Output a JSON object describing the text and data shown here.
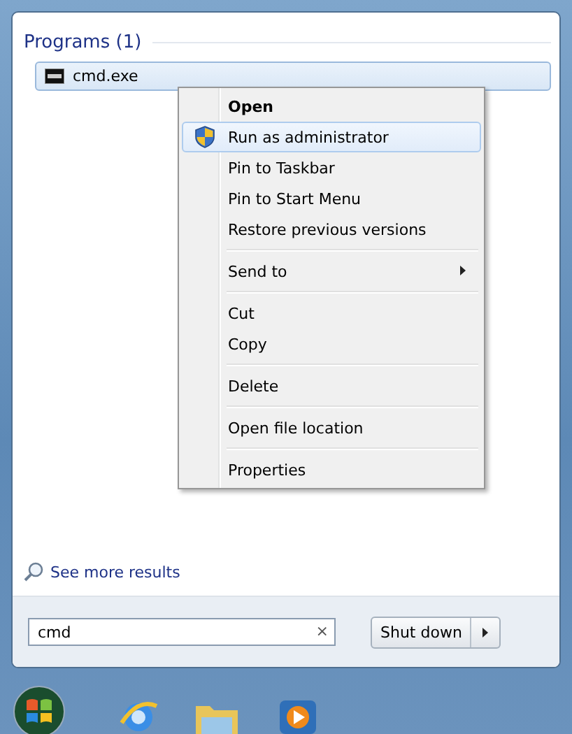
{
  "programs": {
    "heading": "Programs (1)",
    "items": [
      {
        "label": "cmd.exe",
        "selected": true
      }
    ]
  },
  "context_menu": {
    "groups": [
      {
        "items": [
          {
            "label": "Open",
            "kind": "default",
            "selected": false
          },
          {
            "label": "Run as administrator",
            "kind": "elevated",
            "selected": true
          },
          {
            "label": "Pin to Taskbar",
            "kind": "plain",
            "selected": false
          },
          {
            "label": "Pin to Start Menu",
            "kind": "plain",
            "selected": false
          },
          {
            "label": "Restore previous versions",
            "kind": "plain",
            "selected": false
          }
        ]
      },
      {
        "items": [
          {
            "label": "Send to",
            "kind": "submenu",
            "selected": false
          }
        ]
      },
      {
        "items": [
          {
            "label": "Cut",
            "kind": "plain",
            "selected": false
          },
          {
            "label": "Copy",
            "kind": "plain",
            "selected": false
          }
        ]
      },
      {
        "items": [
          {
            "label": "Delete",
            "kind": "plain",
            "selected": false
          }
        ]
      },
      {
        "items": [
          {
            "label": "Open file location",
            "kind": "plain",
            "selected": false
          }
        ]
      },
      {
        "items": [
          {
            "label": "Properties",
            "kind": "plain",
            "selected": false
          }
        ]
      }
    ]
  },
  "see_more": "See more results",
  "search": {
    "value": "cmd",
    "clear": "×"
  },
  "shutdown": {
    "label": "Shut down"
  }
}
